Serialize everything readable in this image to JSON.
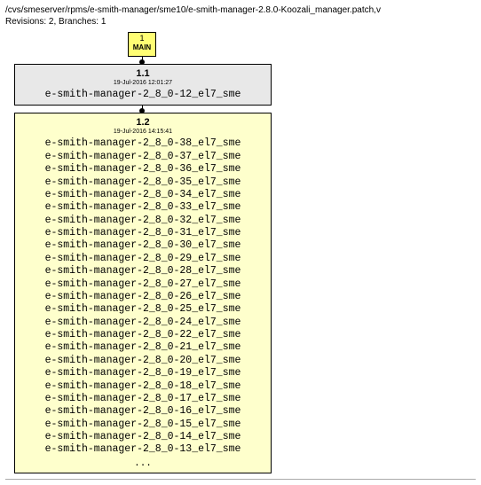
{
  "header": {
    "path": "/cvs/smeserver/rpms/e-smith-manager/sme10/e-smith-manager-2.8.0-Koozali_manager.patch,v",
    "revisions_label": "Revisions: 2, Branches: 1"
  },
  "branch": {
    "num": "1",
    "label": "MAIN"
  },
  "rev1": {
    "version": "1.1",
    "date": "19-Jul-2016 12:01:27",
    "tags": [
      "e-smith-manager-2_8_0-12_el7_sme"
    ]
  },
  "rev2": {
    "version": "1.2",
    "date": "19-Jul-2016 14:15:41",
    "tags": [
      "e-smith-manager-2_8_0-38_el7_sme",
      "e-smith-manager-2_8_0-37_el7_sme",
      "e-smith-manager-2_8_0-36_el7_sme",
      "e-smith-manager-2_8_0-35_el7_sme",
      "e-smith-manager-2_8_0-34_el7_sme",
      "e-smith-manager-2_8_0-33_el7_sme",
      "e-smith-manager-2_8_0-32_el7_sme",
      "e-smith-manager-2_8_0-31_el7_sme",
      "e-smith-manager-2_8_0-30_el7_sme",
      "e-smith-manager-2_8_0-29_el7_sme",
      "e-smith-manager-2_8_0-28_el7_sme",
      "e-smith-manager-2_8_0-27_el7_sme",
      "e-smith-manager-2_8_0-26_el7_sme",
      "e-smith-manager-2_8_0-25_el7_sme",
      "e-smith-manager-2_8_0-24_el7_sme",
      "e-smith-manager-2_8_0-22_el7_sme",
      "e-smith-manager-2_8_0-21_el7_sme",
      "e-smith-manager-2_8_0-20_el7_sme",
      "e-smith-manager-2_8_0-19_el7_sme",
      "e-smith-manager-2_8_0-18_el7_sme",
      "e-smith-manager-2_8_0-17_el7_sme",
      "e-smith-manager-2_8_0-16_el7_sme",
      "e-smith-manager-2_8_0-15_el7_sme",
      "e-smith-manager-2_8_0-14_el7_sme",
      "e-smith-manager-2_8_0-13_el7_sme"
    ],
    "ellipsis": "..."
  }
}
